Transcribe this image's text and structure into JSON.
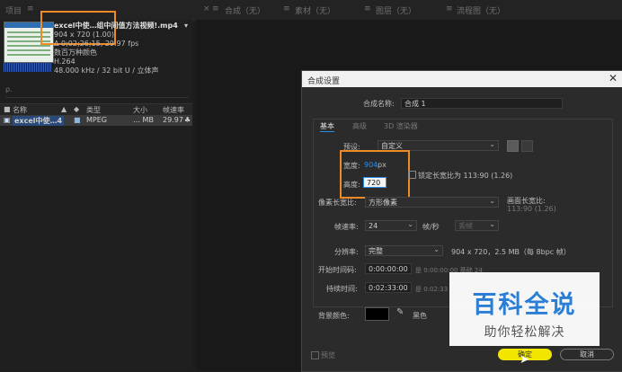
{
  "topbar": {
    "project_label": "项目",
    "comp_tab": "合成（无）",
    "layer_tab": "素材（无）",
    "layer_tab2": "图层（无）",
    "flow_tab": "流程图（无）"
  },
  "project": {
    "file_title": "excel中使…组中间值方法视频!.mp4",
    "resolution": "904 x 720 (1.00)",
    "duration": "Δ 0;02;26;15, 29.97 fps",
    "colors": "数百万种颜色",
    "codec": "H.264",
    "audio": "48.000 kHz / 32 bit U / 立体声",
    "search_placeholder": "ρ.",
    "columns": {
      "name": "名称",
      "type": "类型",
      "size": "大小",
      "rate": "帧速率"
    },
    "file": {
      "name": "excel中使…4",
      "type": "MPEG",
      "size": "… MB",
      "rate": "29.97"
    }
  },
  "dialog": {
    "title": "合成设置",
    "name_label": "合成名称:",
    "name_value": "合成 1",
    "tabs": [
      "基本",
      "高级",
      "3D 渲染器"
    ],
    "preset_label": "预设:",
    "preset_value": "自定义",
    "width_label": "宽度:",
    "width_value": "904",
    "width_unit": "px",
    "height_label": "高度:",
    "height_value": "720",
    "lock_label": "锁定长宽比为 113:90 (1.26)",
    "pixel_aspect_label": "像素长宽比:",
    "pixel_aspect_value": "方形像素",
    "frame_aspect_label": "画面长宽比:",
    "frame_aspect_value": "113:90 (1.26)",
    "fps_label": "帧速率:",
    "fps_value": "24",
    "fps_unit": "帧/秒",
    "fps_mode": "丢帧",
    "resolution_label": "分辨率:",
    "resolution_value": "完整",
    "resolution_info": "904 x 720，2.5 MB（每 8bpc 帧）",
    "start_label": "开始时间码:",
    "start_value": "0:00:00:00",
    "start_info": "是 0:00:00:00 基础 24",
    "duration_label": "持续时间:",
    "duration_value": "0:02:33:00",
    "duration_info": "是 0:02:33",
    "bg_label": "背景颜色:",
    "bg_name": "黑色",
    "preview_label": "预览",
    "ok_label": "确定",
    "cancel_label": "取消",
    "close_icon": "close-icon"
  },
  "watermark": {
    "main": "百科全说",
    "sub": "助你轻松解决"
  },
  "colors": {
    "highlight": "#f08a24",
    "accent_blue": "#2d8ceb",
    "ok_button": "#f2e600"
  }
}
